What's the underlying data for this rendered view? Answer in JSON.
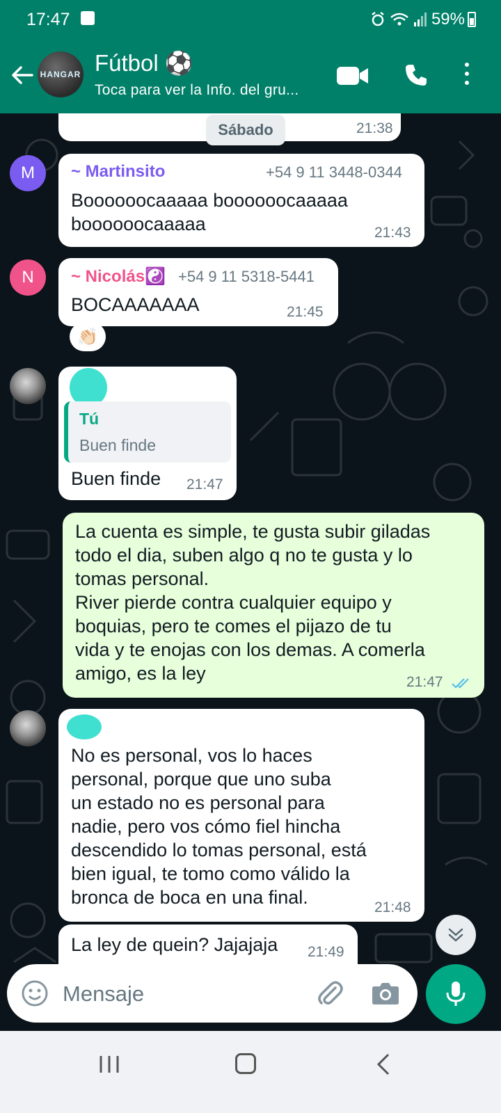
{
  "status_bar": {
    "time": "17:47",
    "battery": "59%"
  },
  "header": {
    "title": "Fútbol ⚽",
    "subtitle": "Toca para ver la Info. del gru...",
    "avatar_text": "HANGAR"
  },
  "chat": {
    "date_divider": "Sábado",
    "first_partial_time": "21:38",
    "messages": [
      {
        "sender": "~ Martinsito",
        "avatar_letter": "M",
        "phone": "+54 9 11 3448-0344",
        "text_lines": [
          "Boooooocaaaaa boooooocaaaaa",
          "boooooocaaaaa"
        ],
        "time": "21:43"
      },
      {
        "sender": "~ Nicolás☯️",
        "avatar_letter": "N",
        "phone": "+54 9 11 5318-5441",
        "text_lines": [
          "BOCAAAAAAA"
        ],
        "time": "21:45",
        "reaction": "👏🏻"
      },
      {
        "quoted_author": "Tú",
        "quoted_text": "Buen finde",
        "text_lines": [
          "Buen finde"
        ],
        "time": "21:47"
      },
      {
        "outgoing": true,
        "text_lines": [
          "La cuenta es simple, te gusta subir giladas",
          "todo el dia, suben algo q no te gusta y lo",
          "tomas personal.",
          "River pierde contra cualquier equipo y",
          "boquias, pero te comes el pijazo de tu",
          "vida y te enojas con los demas. A comerla",
          "amigo, es la ley"
        ],
        "time": "21:47"
      },
      {
        "text_lines": [
          "No es personal, vos lo haces",
          "personal, porque que uno suba",
          "un estado no es personal para",
          "nadie, pero vos cómo fiel hincha",
          "descendido lo tomas personal, está",
          "bien igual, te tomo como válido la",
          "bronca de boca en una final."
        ],
        "time": "21:48"
      },
      {
        "text_lines": [
          "La ley de quein? Jajajaja"
        ],
        "time": "21:49"
      }
    ]
  },
  "input": {
    "placeholder": "Mensaje"
  },
  "colors": {
    "header_green": "#008069",
    "outgoing_bubble": "#e7ffdb",
    "mic_green": "#00a884",
    "martinsito_name": "#7b5cf0",
    "nicolas_name": "#f0538a"
  },
  "icons": [
    "back-arrow-icon",
    "video-call-icon",
    "phone-icon",
    "more-options-icon",
    "emoji-icon",
    "attach-icon",
    "camera-icon",
    "mic-icon",
    "scroll-down-icon",
    "double-check-icon"
  ]
}
